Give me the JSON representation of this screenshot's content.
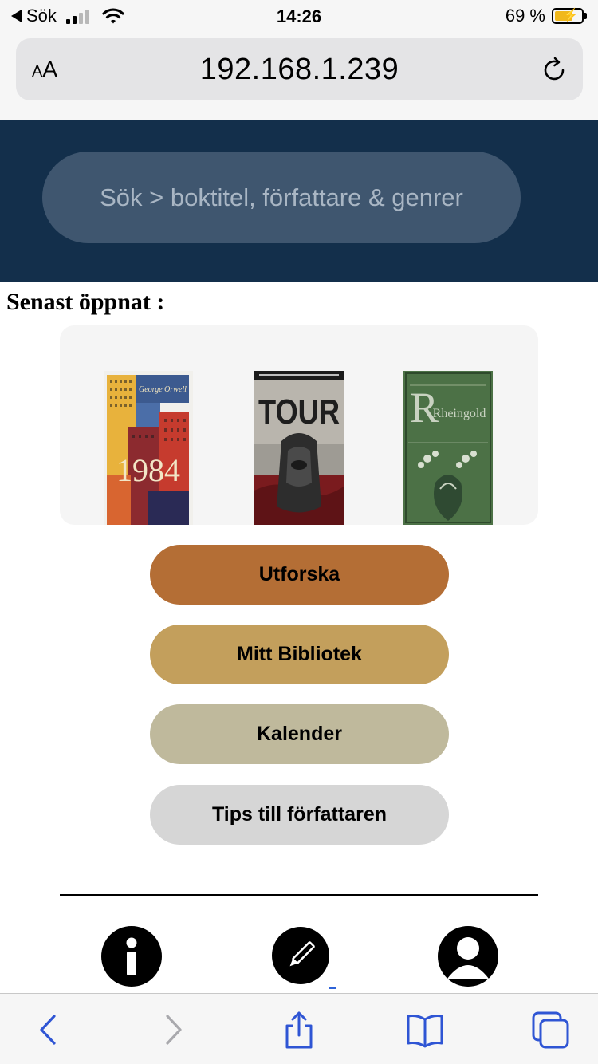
{
  "status_bar": {
    "back_label": "Sök",
    "time": "14:26",
    "battery_percent": "69 %",
    "battery_level": 0.69,
    "signal_bars_active": 2,
    "signal_bars_total": 4
  },
  "browser": {
    "text_size_small": "A",
    "text_size_large": "A",
    "url": "192.168.1.239",
    "reload_icon": "reload-icon"
  },
  "header": {
    "search_placeholder": "Sök > boktitel, författare & genrer",
    "background_color": "#132f4b",
    "search_color": "#3f566f"
  },
  "recent": {
    "title": "Senast öppnat :",
    "books": [
      {
        "author": "George Orwell",
        "title": "1984"
      },
      {
        "title": "TOUR"
      },
      {
        "title": "Rheingold"
      }
    ]
  },
  "menu": {
    "explore": {
      "label": "Utforska",
      "color": "#b46e35"
    },
    "library": {
      "label": "Mitt Bibliotek",
      "color": "#c39f5c"
    },
    "calendar": {
      "label": "Kalender",
      "color": "#bfb99c"
    },
    "tips": {
      "label": "Tips till författaren",
      "color": "#d6d6d6"
    }
  },
  "bottom_nav": [
    "info-icon",
    "pencil-icon",
    "user-icon"
  ],
  "toolbar": [
    "back-arrow-icon",
    "forward-arrow-icon",
    "share-icon",
    "bookmarks-icon",
    "tabs-icon"
  ]
}
